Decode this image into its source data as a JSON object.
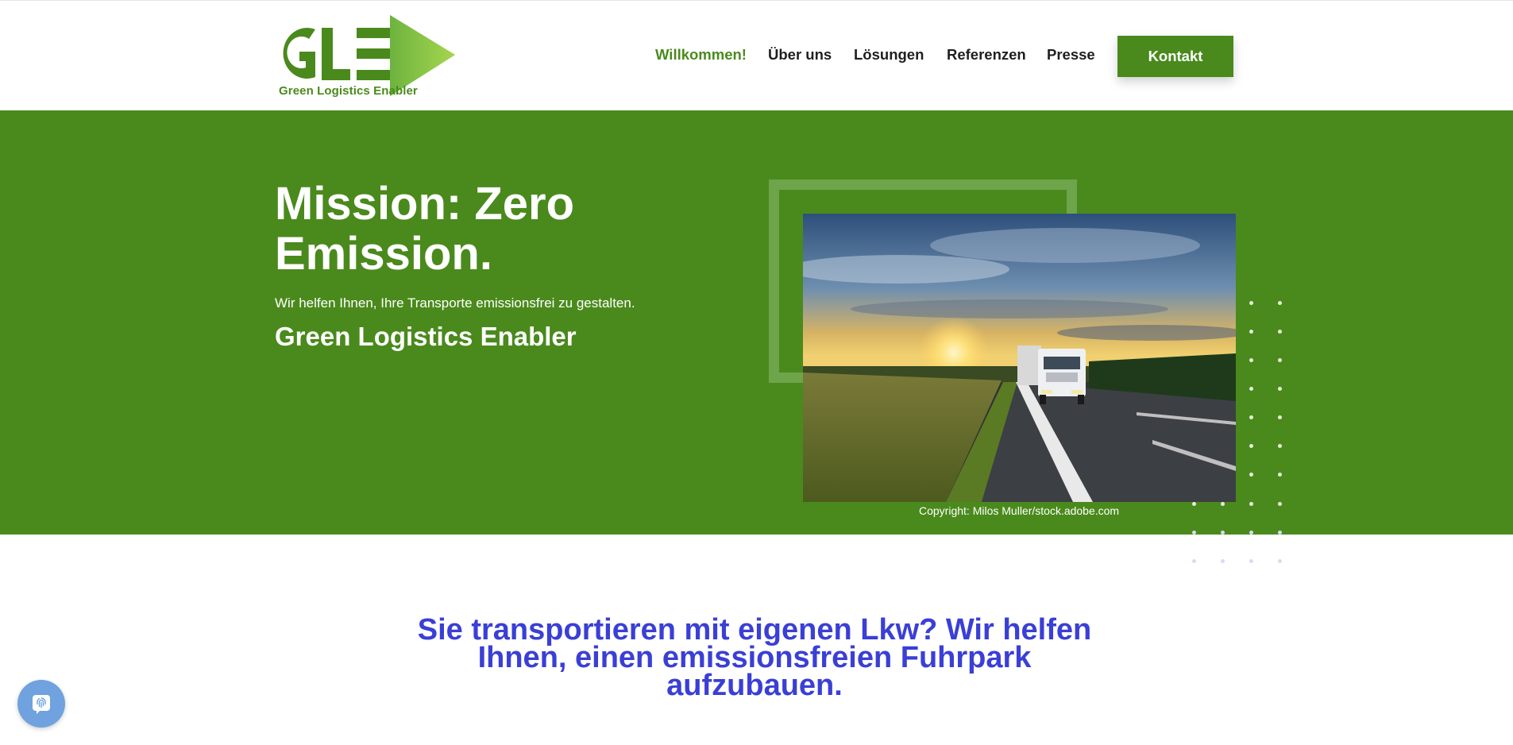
{
  "brand": {
    "logo_letters": "GLE",
    "name": "Green Logistics Enabler",
    "primary_color": "#4a8a1c",
    "accent_light_green": "#8cc63f"
  },
  "nav": {
    "items": [
      {
        "label": "Willkommen!",
        "active": true
      },
      {
        "label": "Über uns",
        "active": false
      },
      {
        "label": "Lösungen",
        "active": false
      },
      {
        "label": "Referenzen",
        "active": false
      },
      {
        "label": "Presse",
        "active": false
      }
    ],
    "cta_label": "Kontakt"
  },
  "hero": {
    "title": "Mission: Zero Emission.",
    "lead": "Wir helfen Ihnen, Ihre Transporte emissionsfrei zu gestalten.",
    "tagline": "Green Logistics Enabler",
    "image_alt": "Lkw auf Landstraße bei Sonnenuntergang",
    "image_credit": "Copyright: Milos Muller/stock.adobe.com",
    "background_color": "#4a8a1c"
  },
  "section": {
    "heading": "Sie transportieren mit eigenen Lkw? Wir helfen Ihnen, einen emissionsfreien Fuhrpark aufzubauen.",
    "heading_color": "#3a3fd6"
  },
  "widgets": {
    "privacy_button_icon": "fingerprint-icon",
    "privacy_button_color": "#6fa2de"
  }
}
